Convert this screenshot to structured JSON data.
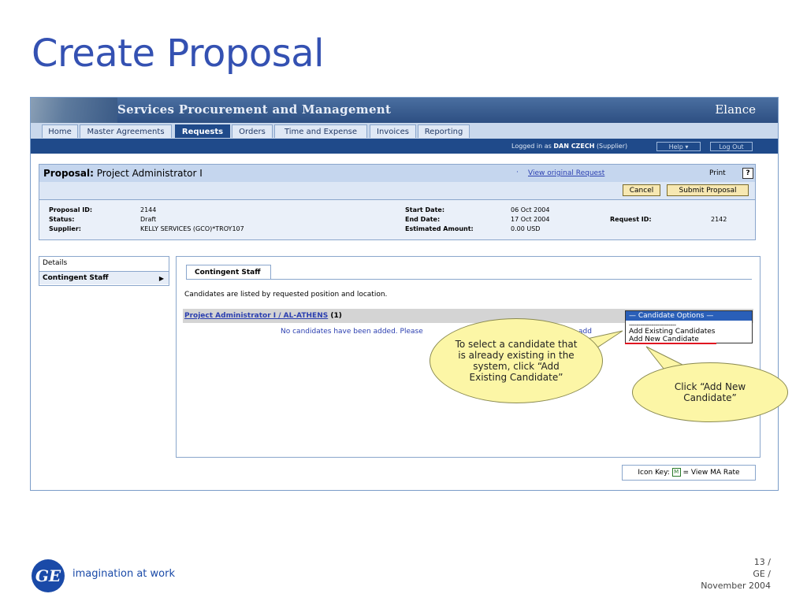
{
  "slide": {
    "title": "Create Proposal",
    "tagline": "imagination at work",
    "logo": "GE",
    "page": "13 /",
    "company": "GE /",
    "date": "November 2004"
  },
  "app": {
    "banner_title": "Services Procurement and Management",
    "brand_logo": "Elance",
    "nav_tabs": [
      "Home",
      "Master Agreements",
      "Requests",
      "Orders",
      "Time and Expense",
      "Invoices",
      "Reporting"
    ],
    "active_tab": "Requests",
    "logged_in_prefix": "Logged in as",
    "logged_in_user": "DAN CZECH",
    "logged_in_role": "(Supplier)",
    "help_label": "Help",
    "logout_label": "Log Out"
  },
  "proposal": {
    "heading_label": "Proposal:",
    "heading_value": "Project Administrator I",
    "view_link": "View original Request",
    "print_label": "Print",
    "help_icon": "?",
    "cancel_label": "Cancel",
    "submit_label": "Submit Proposal",
    "fields": {
      "proposal_id_label": "Proposal ID:",
      "proposal_id": "2144",
      "status_label": "Status:",
      "status": "Draft",
      "supplier_label": "Supplier:",
      "supplier": "KELLY SERVICES (GCO)*TROY107",
      "start_date_label": "Start Date:",
      "start_date": "06 Oct 2004",
      "end_date_label": "End Date:",
      "end_date": "17 Oct 2004",
      "est_amount_label": "Estimated Amount:",
      "est_amount": "0.00 USD",
      "request_id_label": "Request ID:",
      "request_id": "2142"
    }
  },
  "leftnav": {
    "items": [
      "Details",
      "Contingent Staff"
    ]
  },
  "contingent": {
    "tab_label": "Contingent Staff",
    "description": "Candidates are listed by requested position and location.",
    "position_link": "Project Administrator I / AL-ATHENS",
    "position_count": "(1)",
    "no_candidates": "No candidates have been added. Please",
    "no_candidates_tail": "add",
    "dropdown": {
      "selected": "— Candidate Options —",
      "separator": "-------------------------",
      "options": [
        "Add Existing Candidates",
        "Add New Candidate"
      ]
    },
    "icon_key_label": "Icon Key:",
    "icon_key_icon": "M",
    "icon_key_desc": "= View MA Rate"
  },
  "callouts": {
    "existing": "To select a candidate that is already existing in the system, click “Add Existing Candidate”",
    "new": "Click “Add New Candidate”"
  },
  "colors": {
    "title_blue": "#3451b2",
    "nav_blue": "#1f4a8a",
    "callout_yellow": "#fcf6a6",
    "highlight_red": "#e01020"
  }
}
